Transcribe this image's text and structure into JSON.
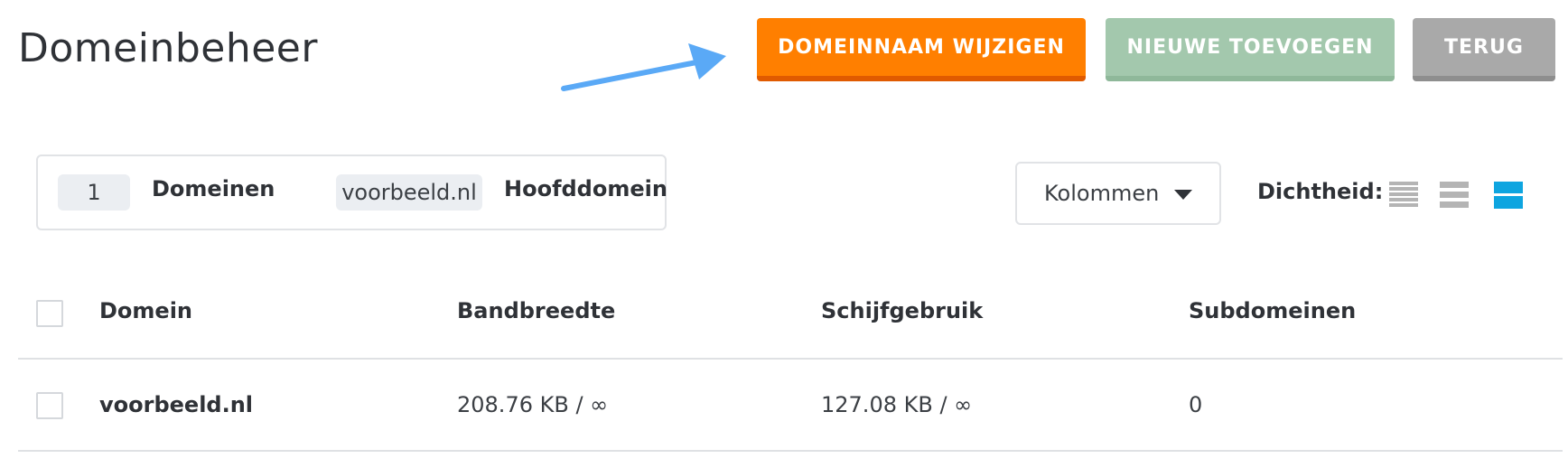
{
  "page": {
    "title": "Domeinbeheer"
  },
  "toolbar": {
    "change_domain_label": "DOMEINNAAM WIJZIGEN",
    "add_new_label": "NIEUWE TOEVOEGEN",
    "back_label": "TERUG"
  },
  "summary": {
    "count": "1",
    "count_label": "Domeinen",
    "main_domain": "voorbeeld.nl",
    "main_domain_label": "Hoofddomein"
  },
  "controls": {
    "columns_label": "Kolommen",
    "density_label": "Dichtheid:",
    "density_active": "wide",
    "icons": [
      "density-compact-icon",
      "density-medium-icon",
      "density-wide-icon"
    ]
  },
  "table": {
    "headers": [
      "Domein",
      "Bandbreedte",
      "Schijfgebruik",
      "Subdomeinen"
    ],
    "rows": [
      {
        "domain": "voorbeeld.nl",
        "bandwidth": "208.76 KB / ∞",
        "disk": "127.08 KB / ∞",
        "subdomains": "0"
      }
    ]
  },
  "colors": {
    "primary": "#ff7f00",
    "add_button": "#a3c8ad",
    "back_button": "#a9a9a9",
    "density_active": "#0ea5e0",
    "density_inactive": "#b4b4b4",
    "annotation_arrow": "#5aa9f6"
  }
}
